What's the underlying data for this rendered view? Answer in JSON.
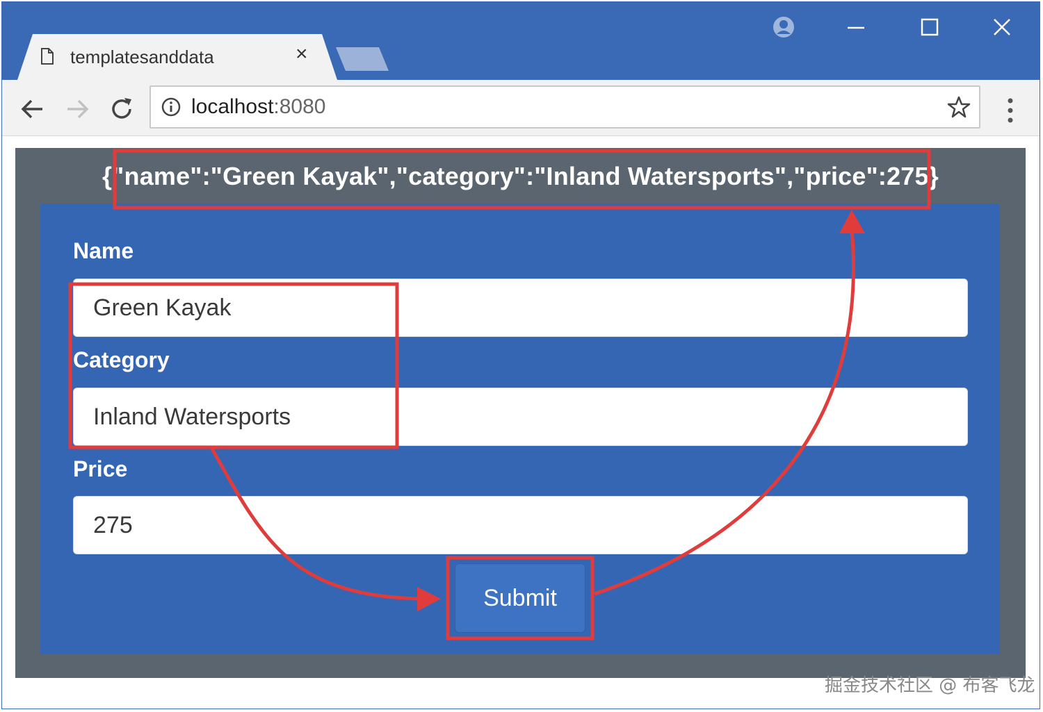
{
  "browser": {
    "tab_title": "templatesanddata",
    "tab_close": "×",
    "url_host": "localhost",
    "url_port": ":8080"
  },
  "page": {
    "json_output": "{\"name\":\"Green Kayak\",\"category\":\"Inland Watersports\",\"price\":275}",
    "form": {
      "name_label": "Name",
      "name_value": "Green Kayak",
      "category_label": "Category",
      "category_value": "Inland Watersports",
      "price_label": "Price",
      "price_value": "275",
      "submit_label": "Submit"
    }
  },
  "watermark": "掘金技术社区 @ 布客飞龙",
  "colors": {
    "titlebar": "#3a69b5",
    "page_background": "#5a6570",
    "form_panel": "#3566b3",
    "annotation": "#e03c3c"
  },
  "icons": [
    "document-icon",
    "close-icon",
    "account-icon",
    "minimize-icon",
    "maximize-icon",
    "window-close-icon",
    "back-arrow-icon",
    "forward-arrow-icon",
    "reload-icon",
    "info-icon",
    "star-icon",
    "menu-dots-icon"
  ]
}
